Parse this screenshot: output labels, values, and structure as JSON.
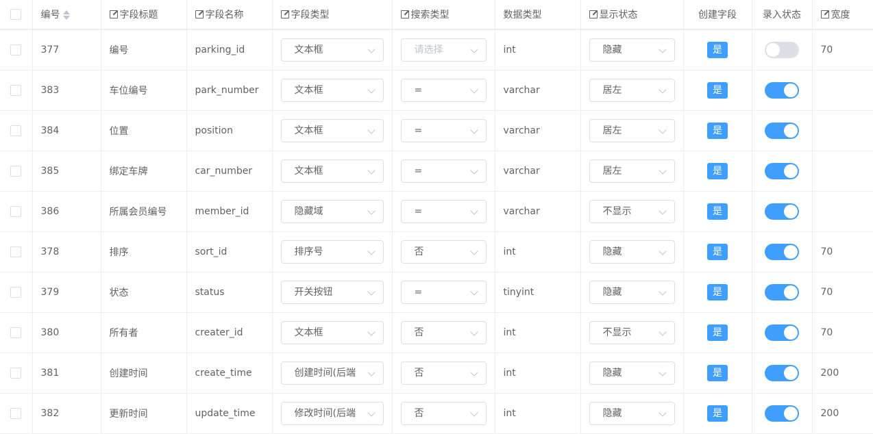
{
  "header": {
    "id": "编号",
    "field_title": "字段标题",
    "field_name": "字段名称",
    "field_type": "字段类型",
    "search_type": "搜索类型",
    "data_type": "数据类型",
    "display_status": "显示状态",
    "create_field": "创建字段",
    "entry_status": "录入状态",
    "width": "宽度"
  },
  "colors": {
    "primary": "#409eff",
    "border": "#ebeef5",
    "switch_off": "#dcdfe6"
  },
  "rows": [
    {
      "id": "377",
      "title": "编号",
      "name": "parking_id",
      "field_type": "文本框",
      "search_type": "请选择",
      "search_placeholder": true,
      "data_type": "int",
      "display": "隐藏",
      "create": "是",
      "entry": false,
      "width": "70"
    },
    {
      "id": "383",
      "title": "车位编号",
      "name": "park_number",
      "field_type": "文本框",
      "search_type": "=",
      "search_placeholder": false,
      "data_type": "varchar",
      "display": "居左",
      "create": "是",
      "entry": true,
      "width": ""
    },
    {
      "id": "384",
      "title": "位置",
      "name": "position",
      "field_type": "文本框",
      "search_type": "=",
      "search_placeholder": false,
      "data_type": "varchar",
      "display": "居左",
      "create": "是",
      "entry": true,
      "width": ""
    },
    {
      "id": "385",
      "title": "绑定车牌",
      "name": "car_number",
      "field_type": "文本框",
      "search_type": "=",
      "search_placeholder": false,
      "data_type": "varchar",
      "display": "居左",
      "create": "是",
      "entry": true,
      "width": ""
    },
    {
      "id": "386",
      "title": "所属会员编号",
      "name": "member_id",
      "field_type": "隐藏域",
      "search_type": "=",
      "search_placeholder": false,
      "data_type": "varchar",
      "display": "不显示",
      "create": "是",
      "entry": true,
      "width": ""
    },
    {
      "id": "378",
      "title": "排序",
      "name": "sort_id",
      "field_type": "排序号",
      "search_type": "否",
      "search_placeholder": false,
      "data_type": "int",
      "display": "隐藏",
      "create": "是",
      "entry": true,
      "width": "70"
    },
    {
      "id": "379",
      "title": "状态",
      "name": "status",
      "field_type": "开关按钮",
      "search_type": "=",
      "search_placeholder": false,
      "data_type": "tinyint",
      "display": "隐藏",
      "create": "是",
      "entry": true,
      "width": "70"
    },
    {
      "id": "380",
      "title": "所有者",
      "name": "creater_id",
      "field_type": "文本框",
      "search_type": "否",
      "search_placeholder": false,
      "data_type": "int",
      "display": "不显示",
      "create": "是",
      "entry": true,
      "width": "70"
    },
    {
      "id": "381",
      "title": "创建时间",
      "name": "create_time",
      "field_type": "创建时间(后端",
      "search_type": "否",
      "search_placeholder": false,
      "data_type": "int",
      "display": "隐藏",
      "create": "是",
      "entry": true,
      "width": "200"
    },
    {
      "id": "382",
      "title": "更新时间",
      "name": "update_time",
      "field_type": "修改时间(后端",
      "search_type": "否",
      "search_placeholder": false,
      "data_type": "int",
      "display": "隐藏",
      "create": "是",
      "entry": true,
      "width": "200"
    }
  ]
}
